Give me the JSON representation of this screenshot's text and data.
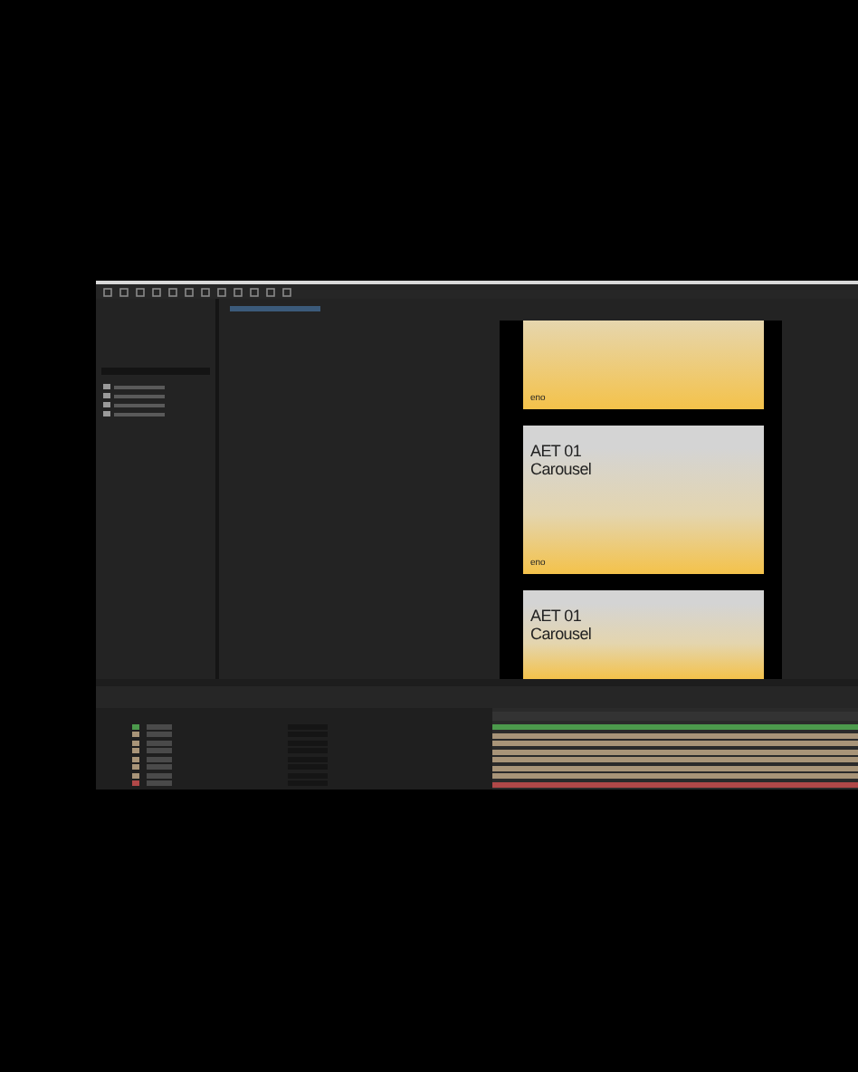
{
  "composition": {
    "cards": [
      {
        "footer": "eno"
      },
      {
        "title": "AET 01",
        "subtitle": "Carousel",
        "footer": "eno"
      },
      {
        "title": "AET 01",
        "subtitle": "Carousel"
      }
    ]
  },
  "timeline": {
    "layers": [
      {
        "color": "#4c9a4c"
      },
      {
        "color": "#a89478"
      },
      {
        "color": "#a89478"
      },
      {
        "color": "#a89478"
      },
      {
        "color": "#a89478"
      },
      {
        "color": "#a89478"
      },
      {
        "color": "#a89478"
      },
      {
        "color": "#b04848"
      }
    ]
  }
}
